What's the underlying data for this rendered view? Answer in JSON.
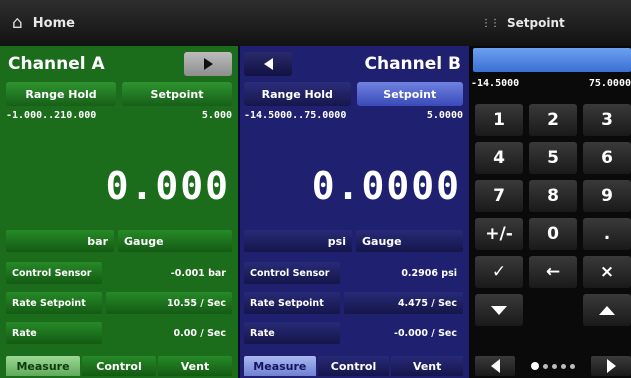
{
  "header": {
    "home_icon": "home-icon",
    "title": "Home"
  },
  "channel_a": {
    "title": "Channel A",
    "buttons": [
      "Range Hold",
      "Setpoint"
    ],
    "range": "-1.000..210.000",
    "setpoint_value": "5.000",
    "reading": "0.000",
    "unit": "bar",
    "mode": "Gauge",
    "rows": [
      {
        "label": "Control Sensor",
        "value": "-0.001 bar"
      },
      {
        "label": "Rate Setpoint",
        "value": "10.55 / Sec"
      },
      {
        "label": "Rate",
        "value": "0.00 / Sec"
      }
    ],
    "tabs": [
      "Measure",
      "Control",
      "Vent"
    ],
    "active_tab": "Measure",
    "color": "#1b6d1b"
  },
  "channel_b": {
    "title": "Channel B",
    "buttons": [
      "Range Hold",
      "Setpoint"
    ],
    "range": "-14.5000..75.0000",
    "setpoint_value": "5.0000",
    "reading": "0.0000",
    "unit": "psi",
    "mode": "Gauge",
    "rows": [
      {
        "label": "Control Sensor",
        "value": "0.2906 psi"
      },
      {
        "label": "Rate Setpoint",
        "value": "4.475 / Sec"
      },
      {
        "label": "Rate",
        "value": "-0.000 / Sec"
      }
    ],
    "tabs": [
      "Measure",
      "Control",
      "Vent"
    ],
    "active_tab": "Measure",
    "color": "#1f2070"
  },
  "setpoint_panel": {
    "title": "Setpoint",
    "input_value": "",
    "range_min": "-14.5000",
    "range_max": "75.0000",
    "keys": [
      "1",
      "2",
      "3",
      "4",
      "5",
      "6",
      "7",
      "8",
      "9",
      "+/-",
      "0",
      ".",
      "✓",
      "←",
      "×"
    ],
    "accent_color": "#4a82e0"
  }
}
